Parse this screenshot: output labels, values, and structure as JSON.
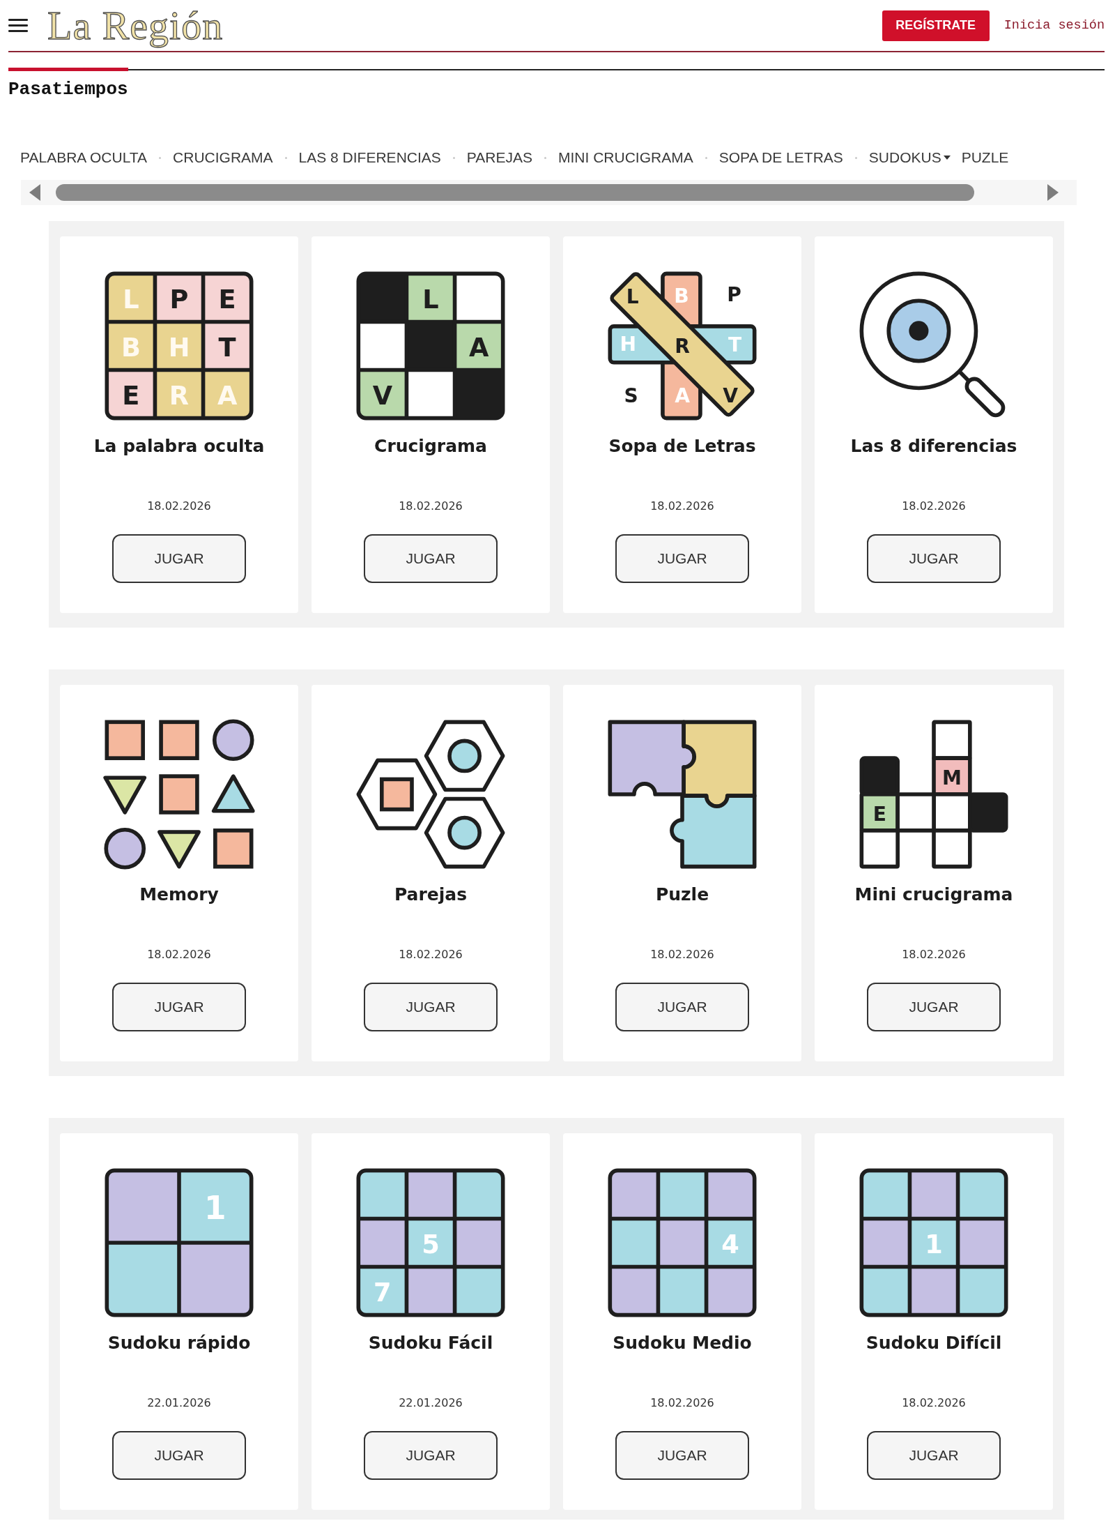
{
  "header": {
    "logo": "La Región",
    "register_button": "REGÍSTRATE",
    "login_link": "Inicia sesión"
  },
  "section_title": "Pasatiempos",
  "nav": [
    {
      "label": "PALABRA OCULTA",
      "dropdown": false
    },
    {
      "label": "CRUCIGRAMA",
      "dropdown": false
    },
    {
      "label": "LAS 8 DIFERENCIAS",
      "dropdown": false
    },
    {
      "label": "PAREJAS",
      "dropdown": false
    },
    {
      "label": "MINI CRUCIGRAMA",
      "dropdown": false
    },
    {
      "label": "SOPA DE LETRAS",
      "dropdown": false
    },
    {
      "label": "SUDOKUS",
      "dropdown": true
    },
    {
      "label": "PUZLE",
      "dropdown": false
    }
  ],
  "panels": [
    {
      "cards": [
        {
          "title": "La palabra oculta",
          "date": "18.02.2026",
          "button": "JUGAR",
          "icon": {
            "kind": "letters",
            "cells": [
              {
                "letter": "L",
                "shaded": true
              },
              {
                "letter": "P",
                "shaded": false
              },
              {
                "letter": "E",
                "shaded": false
              },
              {
                "letter": "B",
                "shaded": true
              },
              {
                "letter": "H",
                "shaded": true
              },
              {
                "letter": "T",
                "shaded": false
              },
              {
                "letter": "E",
                "shaded": false
              },
              {
                "letter": "R",
                "shaded": true
              },
              {
                "letter": "A",
                "shaded": true
              }
            ]
          }
        },
        {
          "title": "Crucigrama",
          "date": "18.02.2026",
          "button": "JUGAR",
          "icon": {
            "kind": "crossword",
            "cells": [
              {
                "blocked": true
              },
              {
                "blocked": false,
                "letter": "L"
              },
              {
                "blocked": false
              },
              {
                "blocked": false
              },
              {
                "blocked": true
              },
              {
                "blocked": false,
                "letter": "A"
              },
              {
                "blocked": false,
                "letter": "V"
              },
              {
                "blocked": false
              },
              {
                "blocked": true
              }
            ]
          }
        },
        {
          "title": "Sopa de Letras",
          "date": "18.02.2026",
          "button": "JUGAR",
          "icon": {
            "kind": "wordsearch",
            "letters": [
              "L",
              "B",
              "P",
              "H",
              "R",
              "T",
              "S",
              "A",
              "V"
            ]
          }
        },
        {
          "title": "Las 8 diferencias",
          "date": "18.02.2026",
          "button": "JUGAR",
          "icon": {
            "kind": "magnifier"
          }
        }
      ]
    },
    {
      "cards": [
        {
          "title": "Memory",
          "date": "18.02.2026",
          "button": "JUGAR",
          "icon": {
            "kind": "shapes",
            "shapes": [
              {
                "kind": "square"
              },
              {
                "kind": "square"
              },
              {
                "kind": "circle"
              },
              {
                "kind": "downtriangle"
              },
              {
                "kind": "square"
              },
              {
                "kind": "triangle"
              },
              {
                "kind": "circle"
              },
              {
                "kind": "downtriangle"
              },
              {
                "kind": "square"
              }
            ]
          }
        },
        {
          "title": "Parejas",
          "date": "18.02.2026",
          "button": "JUGAR",
          "icon": {
            "kind": "hexagons"
          }
        },
        {
          "title": "Puzle",
          "date": "18.02.2026",
          "button": "JUGAR",
          "icon": {
            "kind": "puzzle"
          }
        },
        {
          "title": "Mini crucigrama",
          "date": "18.02.2026",
          "button": "JUGAR",
          "icon": {
            "kind": "minicrossword",
            "letters": [
              "M",
              "E"
            ]
          }
        }
      ]
    },
    {
      "cards": [
        {
          "title": "Sudoku rápido",
          "date": "22.01.2026",
          "button": "JUGAR",
          "icon": {
            "kind": "sudoku",
            "cells": [
              {
                "shaded": true
              },
              {
                "shaded": false,
                "digit": "1"
              },
              {
                "shaded": false
              },
              {
                "shaded": true
              }
            ]
          }
        },
        {
          "title": "Sudoku Fácil",
          "date": "22.01.2026",
          "button": "JUGAR",
          "icon": {
            "kind": "sudoku",
            "cells": [
              {
                "shaded": false
              },
              {
                "shaded": true
              },
              {
                "shaded": false
              },
              {
                "shaded": true
              },
              {
                "shaded": false,
                "digit": "5"
              },
              {
                "shaded": true
              },
              {
                "shaded": false,
                "digit": "7"
              },
              {
                "shaded": true
              },
              {
                "shaded": false
              }
            ]
          }
        },
        {
          "title": "Sudoku Medio",
          "date": "18.02.2026",
          "button": "JUGAR",
          "icon": {
            "kind": "sudoku",
            "cells": [
              {
                "shaded": true
              },
              {
                "shaded": false
              },
              {
                "shaded": true
              },
              {
                "shaded": false
              },
              {
                "shaded": true
              },
              {
                "shaded": false,
                "digit": "4"
              },
              {
                "shaded": true
              },
              {
                "shaded": false
              },
              {
                "shaded": true
              }
            ]
          }
        },
        {
          "title": "Sudoku Difícil",
          "date": "18.02.2026",
          "button": "JUGAR",
          "icon": {
            "kind": "sudoku",
            "cells": [
              {
                "shaded": false
              },
              {
                "shaded": true
              },
              {
                "shaded": false
              },
              {
                "shaded": true
              },
              {
                "shaded": false,
                "digit": "1"
              },
              {
                "shaded": true
              },
              {
                "shaded": false
              },
              {
                "shaded": true
              },
              {
                "shaded": false
              }
            ]
          }
        }
      ]
    }
  ]
}
